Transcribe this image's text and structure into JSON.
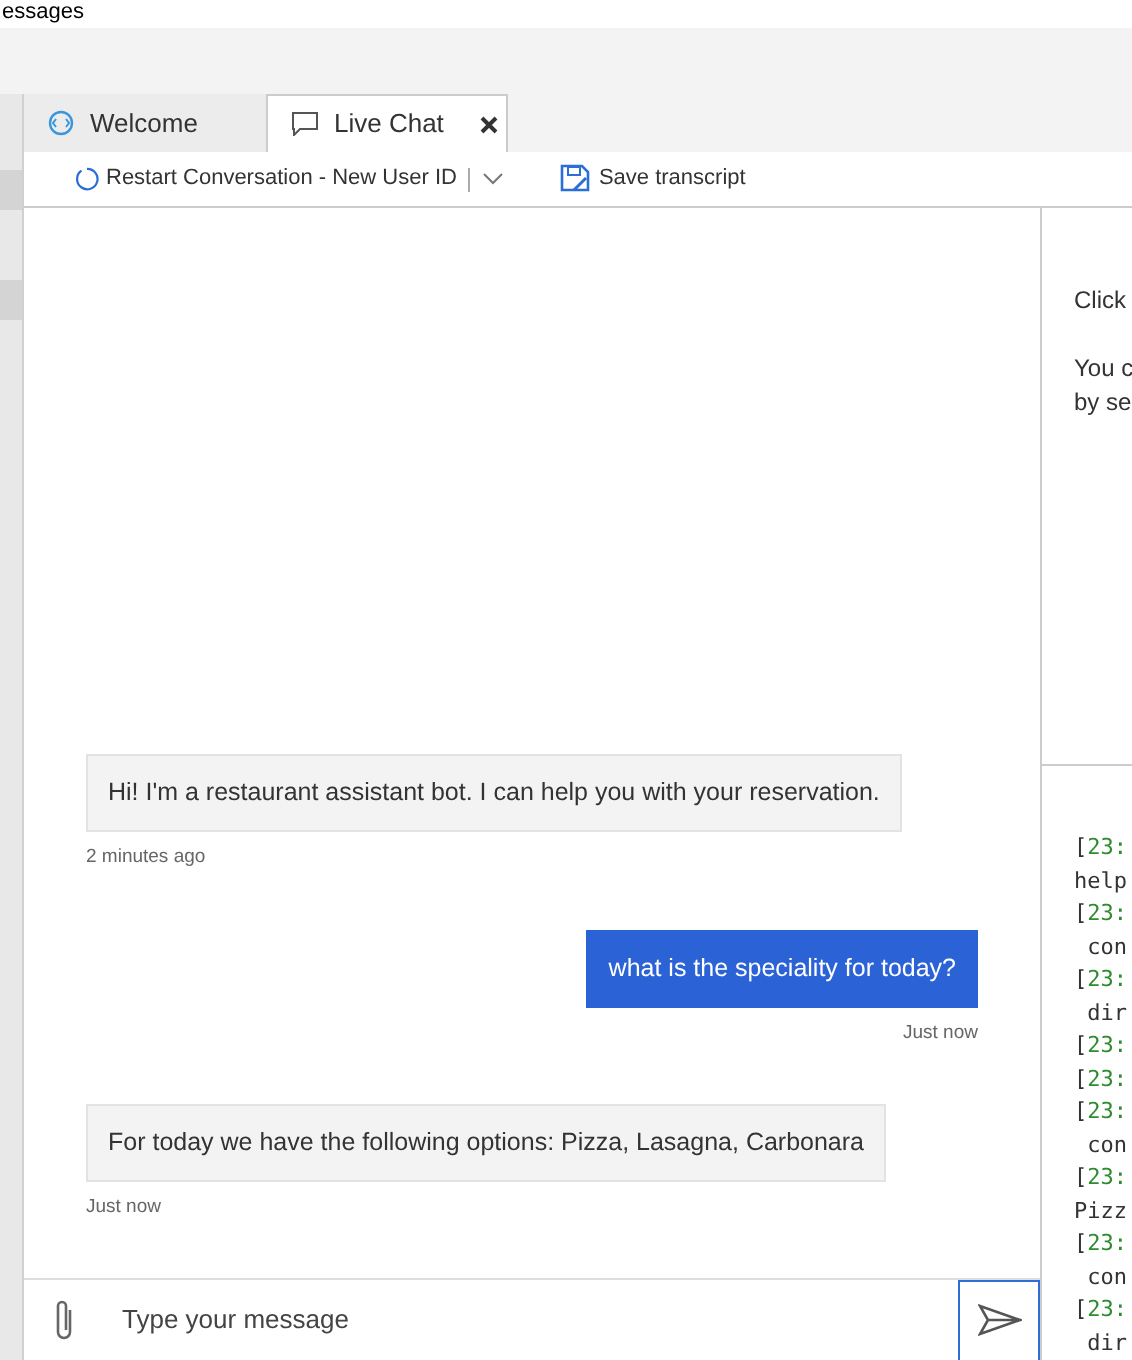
{
  "top_title": "essages",
  "tabs": [
    {
      "label": "Welcome",
      "kind": "welcome",
      "selected": false,
      "closable": false
    },
    {
      "label": "Live Chat",
      "kind": "chat",
      "selected": true,
      "closable": true
    }
  ],
  "toolbar": {
    "restart": "Restart Conversation - New User ID",
    "save": "Save transcript"
  },
  "messages": [
    {
      "kind": "bot",
      "text": "Hi! I'm a restaurant assistant bot. I can help you with your reservation.",
      "time": "2 minutes ago"
    },
    {
      "kind": "user",
      "text": "what is the speciality for today?",
      "time": "Just now"
    },
    {
      "kind": "bot",
      "text": "For today we have the following options: Pizza, Lasagna, Carbonara",
      "time": "Just now"
    }
  ],
  "composer": {
    "placeholder": "Type your message"
  },
  "inspector": {
    "lines": [
      "Click",
      "You c",
      "by se"
    ]
  },
  "log": [
    {
      "kind": "stamp",
      "bracket": "[",
      "time": "23:"
    },
    {
      "kind": "text",
      "text": "help"
    },
    {
      "kind": "stamp",
      "bracket": "[",
      "time": "23:"
    },
    {
      "kind": "text",
      "text": " con"
    },
    {
      "kind": "stamp",
      "bracket": "[",
      "time": "23:"
    },
    {
      "kind": "text",
      "text": " dir"
    },
    {
      "kind": "stamp",
      "bracket": "[",
      "time": "23:"
    },
    {
      "kind": "stamp",
      "bracket": "[",
      "time": "23:"
    },
    {
      "kind": "stamp",
      "bracket": "[",
      "time": "23:"
    },
    {
      "kind": "text",
      "text": " con"
    },
    {
      "kind": "stamp",
      "bracket": "[",
      "time": "23:"
    },
    {
      "kind": "text",
      "text": "Pizz"
    },
    {
      "kind": "stamp",
      "bracket": "[",
      "time": "23:"
    },
    {
      "kind": "text",
      "text": " con"
    },
    {
      "kind": "stamp",
      "bracket": "[",
      "time": "23:"
    },
    {
      "kind": "text",
      "text": " dir"
    }
  ]
}
